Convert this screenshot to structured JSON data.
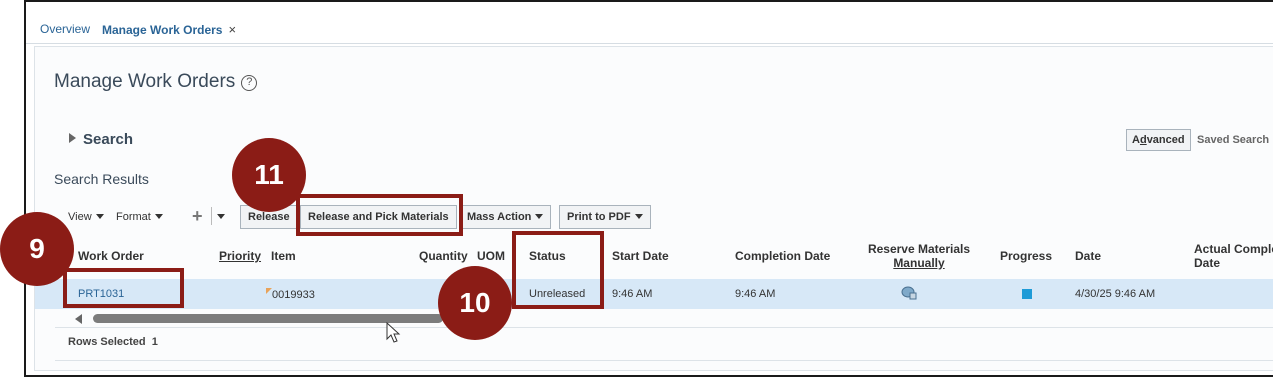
{
  "tabs": {
    "overview": "Overview",
    "active": "Manage Work Orders",
    "close": "×"
  },
  "page": {
    "title": "Manage Work Orders",
    "help": "?"
  },
  "search": {
    "label": "Search",
    "advanced_prefix": "A",
    "advanced_underlined": "d",
    "advanced_suffix": "vanced",
    "saved_search": "Saved Search"
  },
  "results": {
    "title": "Search Results",
    "toolbar": {
      "view": "View",
      "format": "Format",
      "add": "+",
      "release": "Release",
      "release_pick": "Release and Pick Materials",
      "mass_action": "Mass Action",
      "print_pdf": "Print to PDF"
    },
    "columns": {
      "work_order": "Work Order",
      "priority": "Priority",
      "item": "Item",
      "quantity": "Quantity",
      "uom": "UOM",
      "status": "Status",
      "start_date": "Start Date",
      "completion_date": "Completion Date",
      "reserve_line1": "Reserve Materials",
      "reserve_line2": "Manually",
      "progress": "Progress",
      "date": "Date",
      "actual_line1": "Actual Comple",
      "actual_line2": "Date"
    },
    "rows": [
      {
        "work_order": "PRT1031",
        "item": "0019933",
        "status": "Unreleased",
        "start_date": "9:46 AM",
        "completion_date": "9:46 AM",
        "date": "4/30/25 9:46 AM"
      }
    ],
    "rows_selected_label": "Rows Selected",
    "rows_selected_count": "1"
  },
  "callouts": {
    "step_9": "9",
    "step_10": "10",
    "step_11": "11"
  },
  "colors": {
    "callout": "#8b1c16",
    "link": "#2a6496",
    "row_selected": "#d7e8f7",
    "progress": "#1e9bd7"
  },
  "icons": [
    "help-icon",
    "expand-triangle-icon",
    "add-icon",
    "chevron-down-icon",
    "reserve-materials-icon",
    "progress-indicator-icon",
    "scroll-left-icon",
    "mouse-pointer-icon"
  ]
}
